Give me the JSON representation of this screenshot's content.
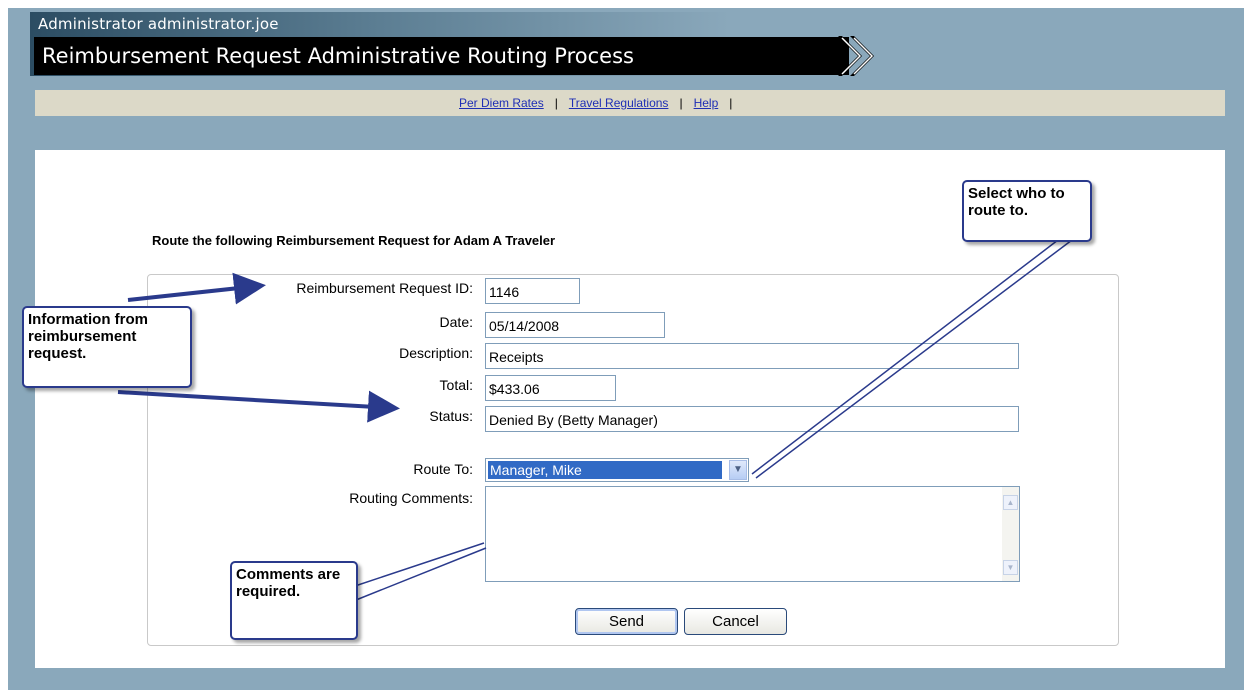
{
  "header": {
    "user_line": "Administrator administrator.joe",
    "title": "Reimbursement Request Administrative Routing Process"
  },
  "nav": {
    "links": [
      "Per Diem Rates",
      "Travel Regulations",
      "Help"
    ],
    "separator": "|"
  },
  "form": {
    "heading": "Route the following Reimbursement Request for Adam A Traveler",
    "fields": {
      "request_id": {
        "label": "Reimbursement Request ID:",
        "value": "1146"
      },
      "date": {
        "label": "Date:",
        "value": "05/14/2008"
      },
      "description": {
        "label": "Description:",
        "value": "Receipts"
      },
      "total": {
        "label": "Total:",
        "value": "$433.06"
      },
      "status": {
        "label": "Status:",
        "value": "Denied By (Betty Manager)"
      }
    },
    "route_to": {
      "label": "Route To:",
      "selected": "Manager, Mike"
    },
    "comments": {
      "label": "Routing Comments:",
      "value": ""
    },
    "buttons": {
      "send": "Send",
      "cancel": "Cancel"
    }
  },
  "callouts": {
    "info": "Information from reimbursement request.",
    "select": "Select who to route to.",
    "comments": "Comments are required."
  },
  "colors": {
    "frame": "#8aa8bb",
    "title_bar": "#000000",
    "nav_bar": "#dcd9c8",
    "link": "#1f2fb5",
    "callout_border": "#2a3a8c",
    "selection": "#316ac5"
  },
  "icons": [
    "double-chevron-right-icon",
    "dropdown-arrow-icon",
    "scroll-up-icon",
    "scroll-down-icon"
  ]
}
